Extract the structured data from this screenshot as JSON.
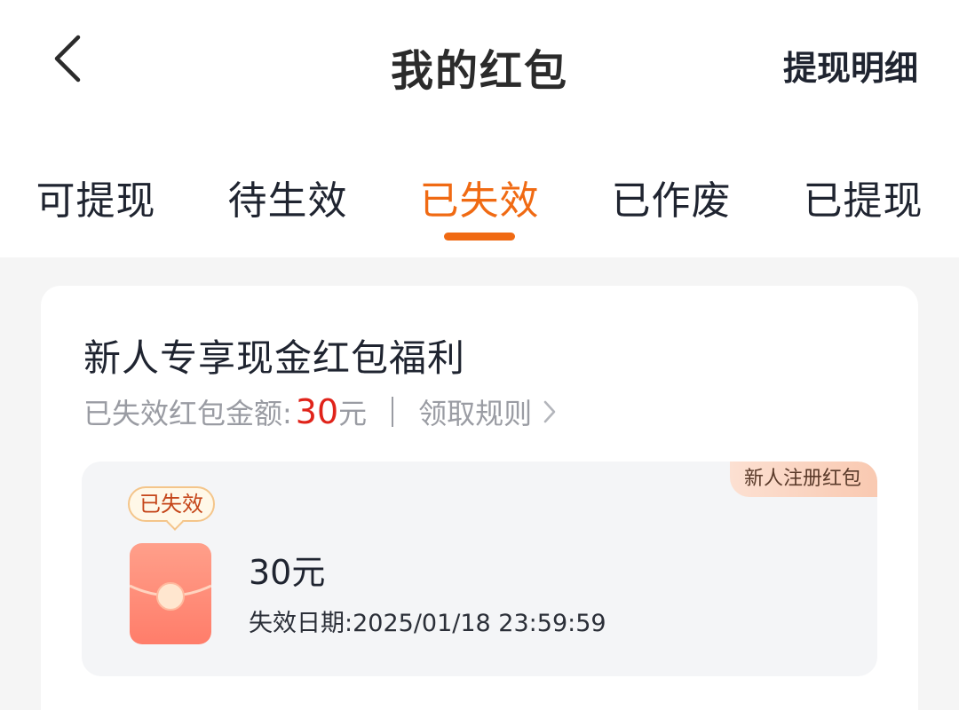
{
  "header": {
    "title": "我的红包",
    "right_link": "提现明细"
  },
  "tabs": [
    {
      "label": "可提现",
      "active": false
    },
    {
      "label": "待生效",
      "active": false
    },
    {
      "label": "已失效",
      "active": true
    },
    {
      "label": "已作废",
      "active": false
    },
    {
      "label": "已提现",
      "active": false
    }
  ],
  "card": {
    "title": "新人专享现金红包福利",
    "summary_label": "已失效红包金额:",
    "summary_amount": "30",
    "summary_unit": "元",
    "rules_link": "领取规则",
    "coupon": {
      "tag": "新人注册红包",
      "status_badge": "已失效",
      "amount": "30元",
      "expire_label": "失效日期:",
      "expire_value": "2025/01/18 23:59:59"
    }
  },
  "colors": {
    "accent": "#f06a13",
    "amount_red": "#e0231a",
    "page_bg": "#f5f5f5"
  },
  "icons": {
    "back": "chevron-left-icon",
    "rules": "chevron-right-icon",
    "packet": "red-packet-icon"
  }
}
